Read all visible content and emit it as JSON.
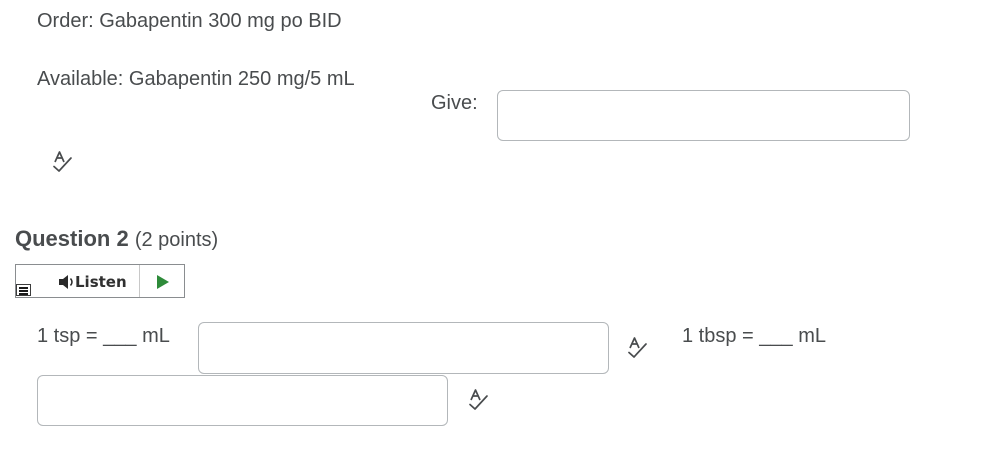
{
  "problem": {
    "order": "Order: Gabapentin 300 mg po BID",
    "available": "Available: Gabapentin 250 mg/5 mL",
    "give_label": "Give:",
    "give_value": ""
  },
  "question2": {
    "title": "Question 2",
    "points": "(2 points)",
    "listen_label": "Listen",
    "tsp_label": "1 tsp = ___ mL",
    "tsp_value": "",
    "tbsp_label": "1 tbsp = ___ mL",
    "tbsp_value": ""
  },
  "colors": {
    "text": "#494c4e",
    "border": "#b3b7ba",
    "play": "#2e8b3a"
  }
}
